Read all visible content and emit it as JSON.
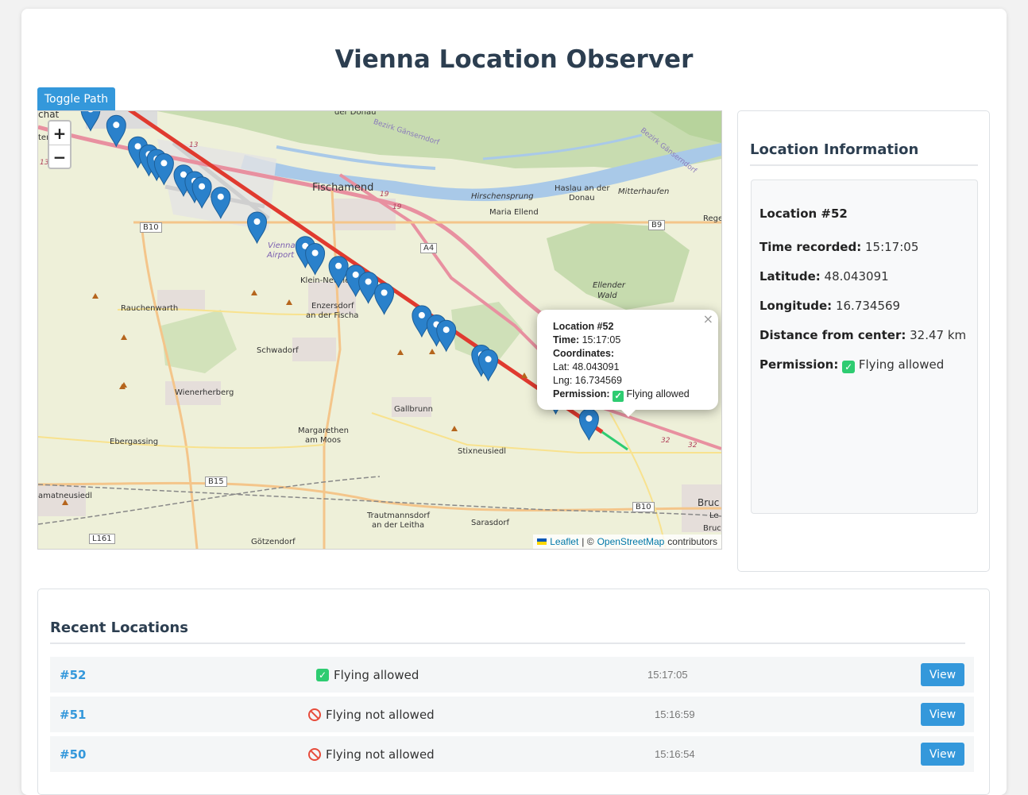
{
  "page": {
    "title": "Vienna Location Observer"
  },
  "toolbar": {
    "toggle_path_label": "Toggle Path"
  },
  "map": {
    "zoom_in": "+",
    "zoom_out": "−",
    "labels": {
      "fischamend": "Fischamend",
      "airport_1": "Vienna",
      "airport_2": "Airport",
      "haslau_1": "Haslau an der",
      "haslau_2": "Donau",
      "mitterhaufen": "Mitterhaufen",
      "maria_ellend": "Maria Ellend",
      "hirschensprung": "Hirschensprung",
      "klein_neusiedl": "Klein-Neusiedl",
      "enzersdorf_1": "Enzersdorf",
      "enzersdorf_2": "an der Fischa",
      "rauchenwarth": "Rauchenwarth",
      "schwadorf": "Schwadorf",
      "wienerherberg": "Wienerherberg",
      "gallbrunn": "Gallbrunn",
      "margarethen_1": "Margarethen",
      "margarethen_2": "am Moos",
      "ebergassing": "Ebergassing",
      "stixneusiedl": "Stixneusiedl",
      "trautmannsdorf_1": "Trautmannsdorf",
      "trautmannsdorf_2": "an der Leitha",
      "sarasdorf": "Sarasdorf",
      "goetzendorf": "Götzendorf",
      "ellender_1": "Ellender",
      "ellender_2": "Wald",
      "bezirk_1": "Bezirk Gänserndorf",
      "bezirk_2": "Bezirk Gänserndorf",
      "der_donau": "der Donau",
      "schwechat": "chat",
      "amatneusiedl": "amatneusiedl",
      "bruck": "Bruc",
      "rege": "Rege",
      "ter": "ter",
      "le": "Le",
      "bruc2": "Bruc",
      "road_b10": "B10",
      "road_b10b": "B10",
      "road_b9": "B9",
      "road_a4": "A4",
      "road_b15": "B15",
      "road_l161": "L161",
      "road_19a": "19",
      "road_19b": "19",
      "road_32a": "32",
      "road_32b": "32",
      "road_13": "13",
      "road_13b": "13"
    },
    "markers": [
      {
        "x": 48.1239,
        "y": 16.4902
      },
      {
        "x": 48.1198,
        "y": 16.5028
      },
      {
        "x": 48.1142,
        "y": 16.5134
      },
      {
        "x": 48.1121,
        "y": 16.5188
      },
      {
        "x": 48.1109,
        "y": 16.5226
      },
      {
        "x": 48.1098,
        "y": 16.5262
      },
      {
        "x": 48.1068,
        "y": 16.5358
      },
      {
        "x": 48.1051,
        "y": 16.5412
      },
      {
        "x": 48.1037,
        "y": 16.5448
      },
      {
        "x": 48.101,
        "y": 16.554
      },
      {
        "x": 48.0945,
        "y": 16.5718
      },
      {
        "x": 48.0881,
        "y": 16.5955
      },
      {
        "x": 48.0863,
        "y": 16.6003
      },
      {
        "x": 48.0829,
        "y": 16.6118
      },
      {
        "x": 48.0806,
        "y": 16.6202
      },
      {
        "x": 48.0788,
        "y": 16.6264
      },
      {
        "x": 48.0759,
        "y": 16.6342
      },
      {
        "x": 48.07,
        "y": 16.6526
      },
      {
        "x": 48.0676,
        "y": 16.6598
      },
      {
        "x": 48.0662,
        "y": 16.6646
      },
      {
        "x": 48.0597,
        "y": 16.6818
      },
      {
        "x": 48.0585,
        "y": 16.6852
      },
      {
        "x": 48.0498,
        "y": 16.7183
      },
      {
        "x": 48.043,
        "y": 16.7346
      }
    ],
    "attribution": {
      "leaflet": "Leaflet",
      "separator": "| ©",
      "osm": "OpenStreetMap",
      "suffix": "contributors"
    },
    "popup": {
      "title": "Location #52",
      "time_label": "Time:",
      "time_value": "15:17:05",
      "coords_label": "Coordinates:",
      "lat_line": "Lat: 48.043091",
      "lng_line": "Lng: 16.734569",
      "permission_label": "Permission:",
      "permission_value": "Flying allowed",
      "close": "×"
    }
  },
  "info": {
    "heading": "Location Information",
    "location_title": "Location #52",
    "time_label": "Time recorded:",
    "time_value": "15:17:05",
    "lat_label": "Latitude:",
    "lat_value": "48.043091",
    "lng_label": "Longitude:",
    "lng_value": "16.734569",
    "distance_label": "Distance from center:",
    "distance_value": "32.47 km",
    "permission_label": "Permission:",
    "permission_value": "Flying allowed"
  },
  "recent": {
    "heading": "Recent Locations",
    "rows": [
      {
        "id": "#52",
        "permission": "Flying allowed",
        "allowed": true,
        "time": "15:17:05",
        "action": "View"
      },
      {
        "id": "#51",
        "permission": "Flying not allowed",
        "allowed": false,
        "time": "15:16:59",
        "action": "View"
      },
      {
        "id": "#50",
        "permission": "Flying not allowed",
        "allowed": false,
        "time": "15:16:54",
        "action": "View"
      }
    ]
  },
  "colors": {
    "accent": "#3498db",
    "allowed": "#2ecc71",
    "not_allowed": "#e74c3c",
    "path": "#e03a2f",
    "marker": "#2a81cb"
  }
}
